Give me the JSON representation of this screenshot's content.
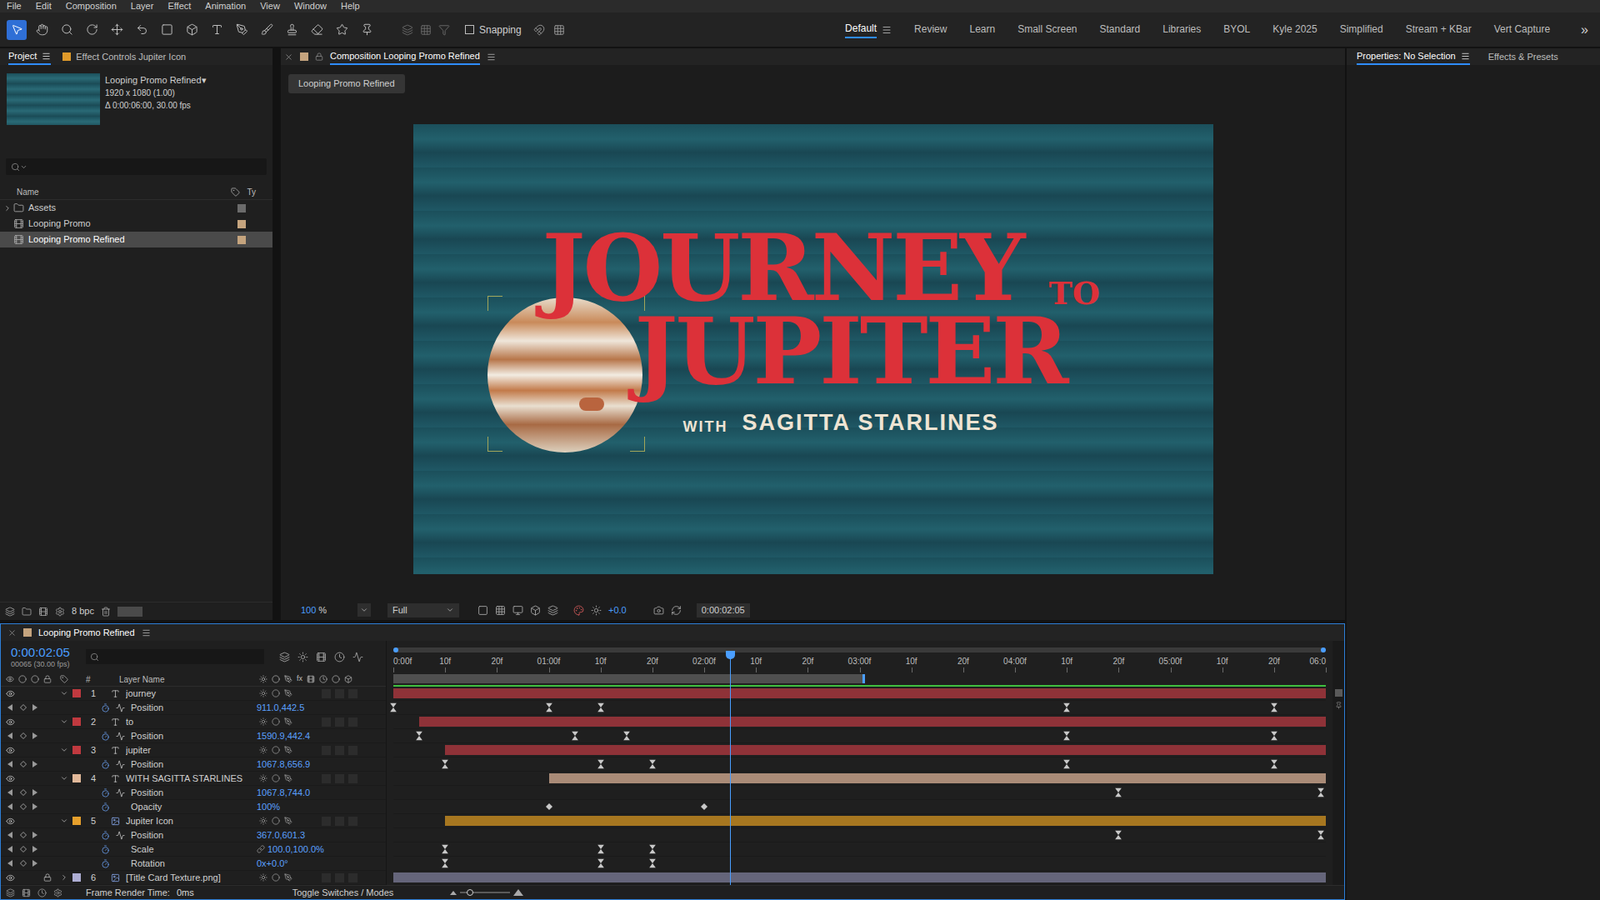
{
  "menu": [
    "File",
    "Edit",
    "Composition",
    "Layer",
    "Effect",
    "Animation",
    "View",
    "Window",
    "Help"
  ],
  "toolbar": {
    "tools": [
      {
        "selected": true
      },
      {
        "selected": false
      },
      {
        "selected": false
      },
      {
        "selected": false
      },
      {
        "selected": false
      },
      {
        "selected": false
      },
      {
        "selected": false
      },
      {
        "selected": false
      },
      {
        "selected": false
      },
      {
        "selected": false
      },
      {
        "selected": false
      },
      {
        "selected": false
      },
      {
        "selected": false
      },
      {
        "selected": false
      },
      {
        "selected": false
      }
    ],
    "snapping": {
      "label": "Snapping",
      "checked": false
    },
    "workspaces": [
      {
        "label": "Default",
        "selected": true
      },
      {
        "label": "Review",
        "selected": false
      },
      {
        "label": "Learn",
        "selected": false
      },
      {
        "label": "Small Screen",
        "selected": false
      },
      {
        "label": "Standard",
        "selected": false
      },
      {
        "label": "Libraries",
        "selected": false
      },
      {
        "label": "BYOL",
        "selected": false
      },
      {
        "label": "Kyle 2025",
        "selected": false
      },
      {
        "label": "Simplified",
        "selected": false
      },
      {
        "label": "Stream + KBar",
        "selected": false
      },
      {
        "label": "Vert Capture",
        "selected": false
      }
    ],
    "overflow": "»"
  },
  "project": {
    "tabs": [
      {
        "label": "Project",
        "selected": true,
        "color": ""
      },
      {
        "label": "Effect Controls Jupiter Icon",
        "selected": false,
        "color": "#e09a2a"
      }
    ],
    "info": {
      "name": "Looping Promo Refined▾",
      "size": "1920 x 1080 (1.00)",
      "duration": "Δ 0:00:06:00, 30.00 fps"
    },
    "columns": {
      "name": "Name",
      "type": "Ty"
    },
    "items": [
      {
        "name": "Assets",
        "kind": "folder",
        "expanded": false,
        "selected": false,
        "color": "#6b6b6b"
      },
      {
        "name": "Looping Promo",
        "kind": "comp",
        "expanded": false,
        "selected": false,
        "color": "#c5a47e"
      },
      {
        "name": "Looping Promo Refined",
        "kind": "comp",
        "expanded": false,
        "selected": true,
        "color": "#c5a47e"
      }
    ],
    "bpc": "8 bpc"
  },
  "composition": {
    "tab": "Composition Looping Promo Refined",
    "breadcrumb": "Looping Promo Refined",
    "canvas": {
      "title_1": "JOURNEY",
      "title_to": "TO",
      "title_2": "JUPITER",
      "with": "WITH",
      "host": "SAGITTA STARLINES"
    },
    "zoom": "100",
    "zoom_unit": "%",
    "resolution": "Full",
    "exposure": "+0.0",
    "time": "0:00:02:05"
  },
  "right_panel": {
    "tabs": [
      {
        "label": "Properties: No Selection",
        "selected": true
      },
      {
        "label": "Effects & Presets",
        "selected": false
      }
    ]
  },
  "timeline": {
    "tab": "Looping Promo Refined",
    "time": "0:00:02:05",
    "frame": "00065 (30.00 fps)",
    "current_frame": 65,
    "duration_frames": 180,
    "work_area_end": 91,
    "ruler": [
      {
        "label": "0:00f",
        "frame": 0
      },
      {
        "label": "10f",
        "frame": 10
      },
      {
        "label": "20f",
        "frame": 20
      },
      {
        "label": "01:00f",
        "frame": 30
      },
      {
        "label": "10f",
        "frame": 40
      },
      {
        "label": "20f",
        "frame": 50
      },
      {
        "label": "02:00f",
        "frame": 60
      },
      {
        "label": "10f",
        "frame": 70
      },
      {
        "label": "20f",
        "frame": 80
      },
      {
        "label": "03:00f",
        "frame": 90
      },
      {
        "label": "10f",
        "frame": 100
      },
      {
        "label": "20f",
        "frame": 110
      },
      {
        "label": "04:00f",
        "frame": 120
      },
      {
        "label": "10f",
        "frame": 130
      },
      {
        "label": "20f",
        "frame": 140
      },
      {
        "label": "05:00f",
        "frame": 150
      },
      {
        "label": "10f",
        "frame": 160
      },
      {
        "label": "20f",
        "frame": 170
      },
      {
        "label": "06:0",
        "frame": 180
      }
    ],
    "columns": {
      "number": "#",
      "name": "Layer Name"
    },
    "rows": [
      {
        "kind": "layer",
        "index": "1",
        "name": "journey",
        "type": "text",
        "expanded": true,
        "locked": false,
        "color": "#c0393f",
        "bar_color": "#8f3238",
        "in": 0
      },
      {
        "kind": "property",
        "name": "Position",
        "value": "911.0,442.5",
        "graph": true,
        "linked": false,
        "keyframe_kind": "ease",
        "keyframes": [
          0,
          30,
          40,
          130,
          170
        ]
      },
      {
        "kind": "layer",
        "index": "2",
        "name": "to",
        "type": "text",
        "expanded": true,
        "locked": false,
        "color": "#c0393f",
        "bar_color": "#8f3238",
        "in": 5
      },
      {
        "kind": "property",
        "name": "Position",
        "value": "1590.9,442.4",
        "graph": true,
        "linked": false,
        "keyframe_kind": "ease",
        "keyframes": [
          5,
          35,
          45,
          130,
          170
        ]
      },
      {
        "kind": "layer",
        "index": "3",
        "name": "jupiter",
        "type": "text",
        "expanded": true,
        "locked": false,
        "color": "#c0393f",
        "bar_color": "#8f3238",
        "in": 10
      },
      {
        "kind": "property",
        "name": "Position",
        "value": "1067.8,656.9",
        "graph": true,
        "linked": false,
        "keyframe_kind": "ease",
        "keyframes": [
          10,
          40,
          50,
          130,
          170
        ]
      },
      {
        "kind": "layer",
        "index": "4",
        "name": "WITH SAGITTA STARLINES",
        "type": "text",
        "expanded": true,
        "locked": false,
        "color": "#e2b99a",
        "bar_color": "#a98b77",
        "in": 30
      },
      {
        "kind": "property",
        "name": "Position",
        "value": "1067.8,744.0",
        "graph": true,
        "linked": false,
        "keyframe_kind": "ease",
        "keyframes": [
          140,
          179
        ]
      },
      {
        "kind": "property",
        "name": "Opacity",
        "value": "100%",
        "graph": false,
        "linked": false,
        "keyframe_kind": "linear",
        "keyframes": [
          30,
          60
        ]
      },
      {
        "kind": "layer",
        "index": "5",
        "name": "Jupiter Icon",
        "type": "image",
        "expanded": true,
        "locked": false,
        "color": "#e6a02c",
        "bar_color": "#a77720",
        "in": 10
      },
      {
        "kind": "property",
        "name": "Position",
        "value": "367.0,601.3",
        "graph": true,
        "linked": false,
        "keyframe_kind": "ease",
        "keyframes": [
          140,
          179
        ]
      },
      {
        "kind": "property",
        "name": "Scale",
        "value": "100.0,100.0%",
        "graph": false,
        "linked": true,
        "keyframe_kind": "ease",
        "keyframes": [
          10,
          40,
          50
        ]
      },
      {
        "kind": "property",
        "name": "Rotation",
        "value": "0x+0.0°",
        "graph": false,
        "linked": false,
        "keyframe_kind": "ease",
        "keyframes": [
          10,
          40,
          50
        ]
      },
      {
        "kind": "layer",
        "index": "6",
        "name": "[Title Card Texture.png]",
        "type": "image",
        "expanded": false,
        "locked": true,
        "color": "#aeaed4",
        "bar_color": "#65657a",
        "in": 0
      }
    ],
    "footer": {
      "label": "Frame Render Time:",
      "value": "0ms",
      "toggle": "Toggle Switches / Modes"
    }
  }
}
